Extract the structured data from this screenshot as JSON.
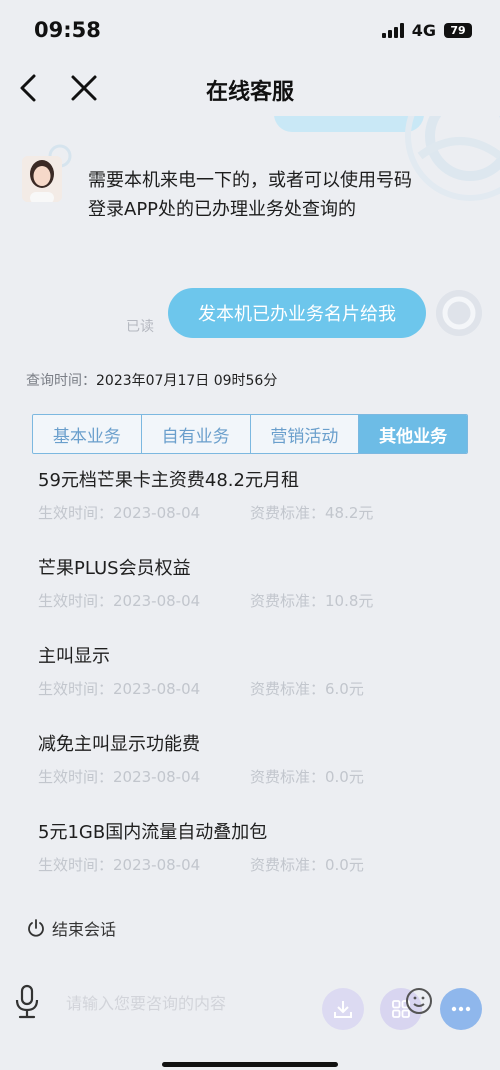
{
  "status_bar": {
    "time": "09:58",
    "network": "4G",
    "battery": "79"
  },
  "nav": {
    "title": "在线客服"
  },
  "chat": {
    "agent_message": "需要本机来电一下的，或者可以使用号码登录APP处的已办理业务处查询的",
    "user_message": "发本机已办业务名片给我",
    "read_label": "已读"
  },
  "card": {
    "query_label": "查询时间：",
    "query_value": "2023年07月17日 09时56分",
    "tabs": [
      {
        "label": "基本业务",
        "active": false
      },
      {
        "label": "自有业务",
        "active": false
      },
      {
        "label": "营销活动",
        "active": false
      },
      {
        "label": "其他业务",
        "active": true
      }
    ],
    "services": [
      {
        "name": "59元档芒果卡主资费48.2元月租",
        "date": "生效时间：2023-08-04",
        "fee": "资费标准：48.2元"
      },
      {
        "name": "芒果PLUS会员权益",
        "date": "生效时间：2023-08-04",
        "fee": "资费标准：10.8元"
      },
      {
        "name": "主叫显示",
        "date": "生效时间：2023-08-04",
        "fee": "资费标准：6.0元"
      },
      {
        "name": "减免主叫显示功能费",
        "date": "生效时间：2023-08-04",
        "fee": "资费标准：0.0元"
      },
      {
        "name": "5元1GB国内流量自动叠加包",
        "date": "生效时间：2023-08-04",
        "fee": "资费标准：0.0元"
      }
    ]
  },
  "end_session": "结束会话",
  "input": {
    "placeholder": "请输入您要咨询的内容"
  },
  "icons": [
    "back-icon",
    "close-icon",
    "power-icon",
    "microphone-icon",
    "download-icon",
    "grid-icon",
    "emoji-icon",
    "more-icon"
  ],
  "colors": {
    "accent": "#6dc6ec",
    "tab_active": "#6dbce6",
    "tab_border": "#7cb8e0",
    "muted": "#c2c6cd"
  }
}
